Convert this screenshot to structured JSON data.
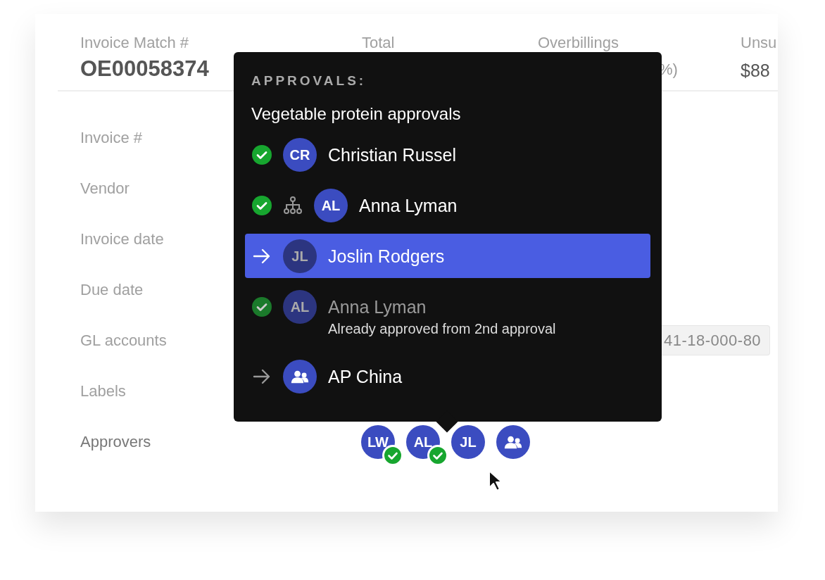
{
  "summary": [
    {
      "label": "Invoice Match #",
      "value": "OE00058374",
      "kind": "id"
    },
    {
      "label": "Total"
    },
    {
      "label": "Overbillings",
      "value": "%)",
      "kind": "muted"
    },
    {
      "label": "Unsu",
      "value": "$88",
      "kind": "amount"
    }
  ],
  "fields": [
    {
      "label": "Invoice #",
      "kind": "empty"
    },
    {
      "label": "Vendor",
      "kind": "empty"
    },
    {
      "label": "Invoice date",
      "kind": "empty"
    },
    {
      "label": "Due date",
      "kind": "empty"
    },
    {
      "label": "GL accounts",
      "kind": "chip",
      "value": "41-18-000-80"
    },
    {
      "label": "Labels",
      "kind": "empty"
    },
    {
      "label": "Approvers",
      "kind": "approvers"
    }
  ],
  "approvers": [
    {
      "initials": "LW",
      "kind": "person",
      "approved": true
    },
    {
      "initials": "AL",
      "kind": "person",
      "approved": true
    },
    {
      "initials": "JL",
      "kind": "person",
      "approved": false
    },
    {
      "kind": "group",
      "approved": false
    }
  ],
  "popover": {
    "heading": "APPROVALS:",
    "title": "Vegetable protein approvals",
    "rows": [
      {
        "approved": true,
        "org_chart": false,
        "kind": "person",
        "initials": "CR",
        "name": "Christian Russel",
        "selected": false,
        "disabled": false
      },
      {
        "approved": true,
        "org_chart": true,
        "kind": "person",
        "initials": "AL",
        "name": "Anna Lyman",
        "selected": false,
        "disabled": false
      },
      {
        "approved": false,
        "org_chart": false,
        "kind": "person",
        "initials": "JL",
        "name": "Joslin Rodgers",
        "selected": true,
        "disabled": false
      },
      {
        "approved": true,
        "org_chart": false,
        "kind": "person",
        "initials": "AL",
        "name": "Anna Lyman",
        "note": "Already approved from 2nd approval",
        "selected": false,
        "disabled": true
      },
      {
        "approved": false,
        "org_chart": false,
        "kind": "group",
        "name": "AP China",
        "selected": false,
        "disabled": false
      }
    ]
  }
}
